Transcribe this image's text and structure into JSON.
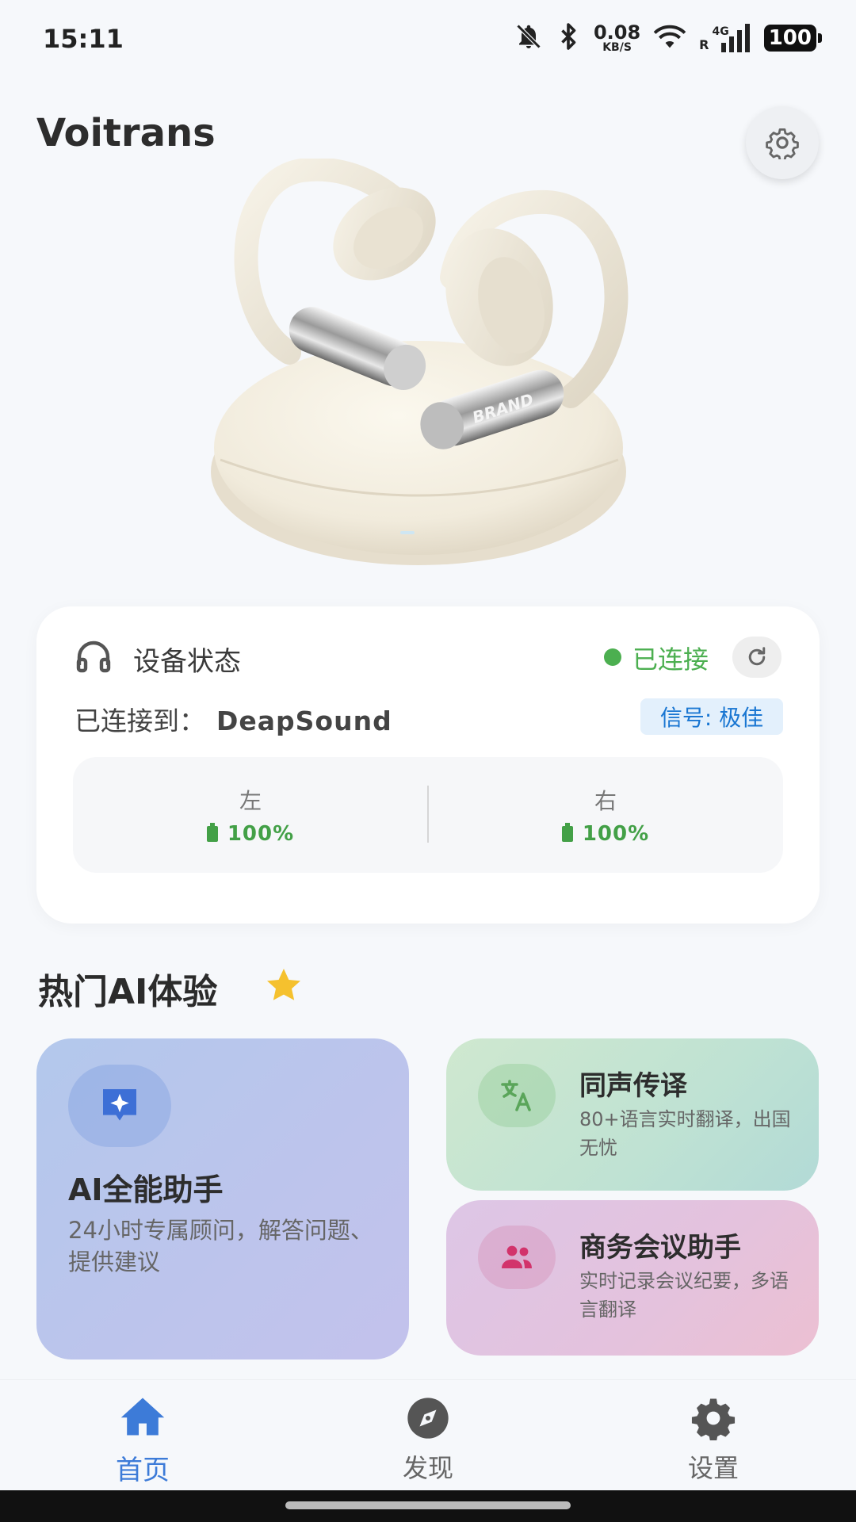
{
  "status_bar": {
    "time": "15:11",
    "net_speed_value": "0.08",
    "net_speed_unit": "KB/S",
    "network_type": "4G",
    "roaming": "R",
    "battery_level": "100"
  },
  "header": {
    "app_title": "Voitrans"
  },
  "hero": {
    "product_brand": "BRAND"
  },
  "device_status": {
    "title": "设备状态",
    "connection_status": "已连接",
    "connected_label": "已连接到：",
    "device_name": "DeapSound",
    "signal": "信号: 极佳",
    "left_label": "左",
    "left_battery": "100%",
    "right_label": "右",
    "right_battery": "100%"
  },
  "section": {
    "title": "热门AI体验"
  },
  "cards": {
    "ai": {
      "title": "AI全能助手",
      "desc": "24小时专属顾问，解答问题、提供建议"
    },
    "translate": {
      "title": "同声传译",
      "desc": "80+语言实时翻译，出国无忧"
    },
    "meeting": {
      "title": "商务会议助手",
      "desc": "实时记录会议纪要，多语言翻译"
    }
  },
  "bottom_nav": {
    "home": "首页",
    "discover": "发现",
    "settings": "设置"
  },
  "colors": {
    "accent": "#3d7bd8",
    "connected_green": "#4caf50",
    "signal_blue": "#1976d2",
    "star": "#f5c12e"
  }
}
